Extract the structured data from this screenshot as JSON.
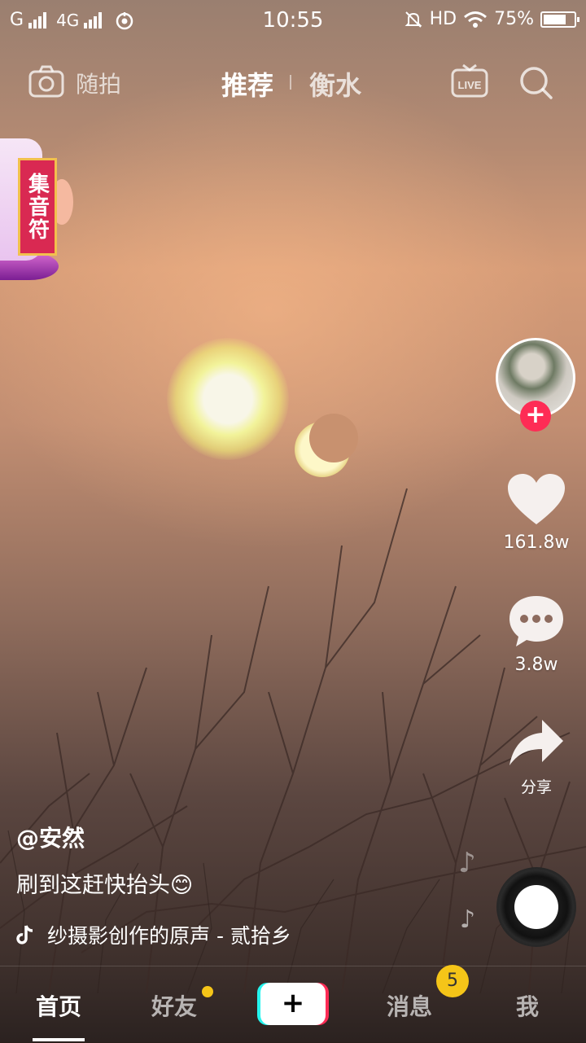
{
  "status_bar": {
    "carrier1": "G",
    "carrier2": "4G",
    "time": "10:55",
    "hd": "HD",
    "battery": "75%",
    "battery_level": 0.75
  },
  "top_nav": {
    "camera_label": "随拍",
    "tab_recommend": "推荐",
    "tab_city": "衡水",
    "live_icon": "live-tv-icon",
    "search_icon": "search-icon"
  },
  "activity_badge": {
    "text": "集音符"
  },
  "right_rail": {
    "follow_symbol": "+",
    "likes": "161.8w",
    "comments": "3.8w",
    "share_label": "分享"
  },
  "video_info": {
    "author": "@安然",
    "description": "刷到这赶快抬头😊",
    "music": "纱摄影创作的原声 - 贰拾乡"
  },
  "bottom_nav": {
    "home": "首页",
    "friends": "好友",
    "plus": "+",
    "messages": "消息",
    "messages_badge": "5",
    "me": "我"
  },
  "colors": {
    "accent_red": "#fe2c55",
    "accent_cyan": "#25f4ee",
    "badge_yellow": "#f5c518"
  }
}
